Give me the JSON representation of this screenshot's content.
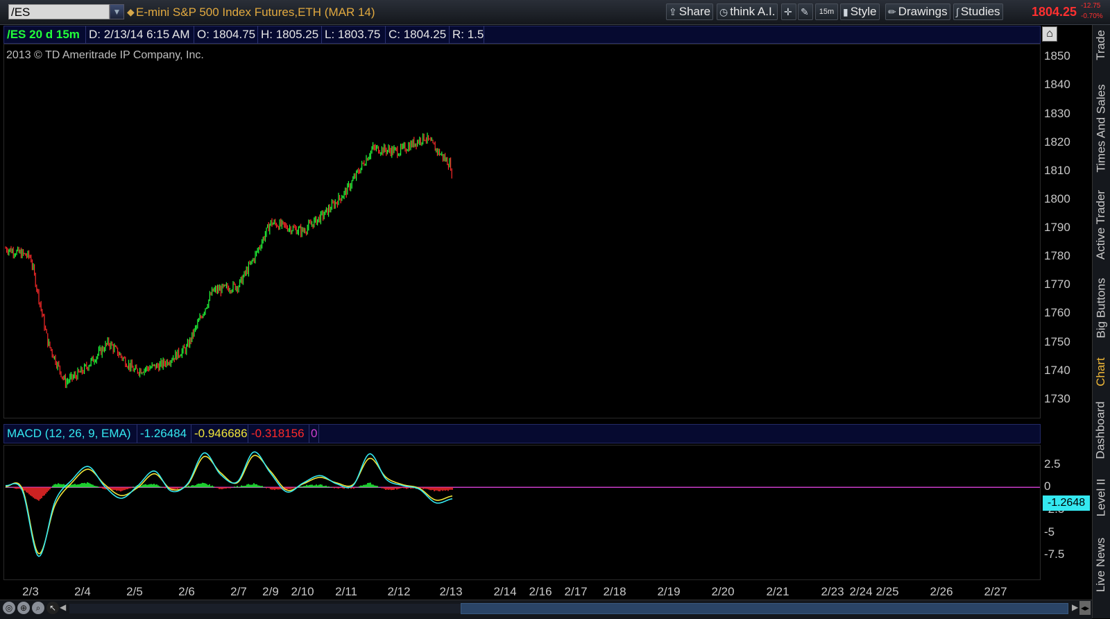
{
  "toolbar": {
    "symbol": "/ES",
    "title": "E-mini S&P 500 Index Futures,ETH (MAR 14)",
    "share_label": "Share",
    "thinkai_label": "think A.I.",
    "timeframe_label": "15m",
    "style_label": "Style",
    "drawings_label": "Drawings",
    "studies_label": "Studies",
    "last_price": "1804.25",
    "change": "-12.75",
    "change_pct": "-0.70%"
  },
  "info": {
    "symbol_period": "/ES 20 d 15m",
    "date": "D: 2/13/14 6:15 AM",
    "open": "O: 1804.75",
    "high": "H: 1805.25",
    "low": "L: 1803.75",
    "close": "C: 1804.25",
    "range": "R: 1.5"
  },
  "copyright": "2013 © TD Ameritrade IP Company, Inc.",
  "macd": {
    "label": "MACD (12, 26, 9, EMA)",
    "value": "-1.26484",
    "avg": "-0.946686",
    "diff": "-0.318156",
    "zero": "0",
    "tag": "-1.2648"
  },
  "side_tabs": [
    "Trade",
    "Times And Sales",
    "Active Trader",
    "Big Buttons",
    "Chart",
    "Dashboard",
    "Level II",
    "Live News"
  ],
  "colors": {
    "up": "#22ff3a",
    "down": "#ff2a2a",
    "macd_value": "#34e8f0",
    "macd_avg": "#f2e63a",
    "macd_diff_pos": "#22ff3a",
    "macd_diff_neg": "#ff2a2a",
    "zero_line": "#c83cc8",
    "accent": "#e1a93f"
  },
  "chart_data": [
    {
      "type": "candlestick",
      "title": "E-mini S&P 500 Index Futures,ETH (MAR 14)",
      "x_labels": [
        "2/3",
        "2/4",
        "2/5",
        "2/6",
        "2/7",
        "2/9",
        "2/10",
        "2/11",
        "2/12",
        "2/13",
        "2/14",
        "2/16",
        "2/17",
        "2/18",
        "2/19",
        "2/20",
        "2/21",
        "2/23",
        "2/24",
        "2/25",
        "2/26",
        "2/27"
      ],
      "y_ticks": [
        1730,
        1740,
        1750,
        1760,
        1770,
        1780,
        1790,
        1800,
        1810,
        1820,
        1830,
        1840,
        1850
      ],
      "ylim": [
        1728,
        1853
      ],
      "approx_close_path": [
        {
          "x": "2/2",
          "y": 1783
        },
        {
          "x": "2/3",
          "y": 1780
        },
        {
          "x": "2/3",
          "y": 1750
        },
        {
          "x": "2/3",
          "y": 1736
        },
        {
          "x": "2/4",
          "y": 1740
        },
        {
          "x": "2/4",
          "y": 1750
        },
        {
          "x": "2/5",
          "y": 1740
        },
        {
          "x": "2/5",
          "y": 1742
        },
        {
          "x": "2/6",
          "y": 1748
        },
        {
          "x": "2/6",
          "y": 1768
        },
        {
          "x": "2/7",
          "y": 1770
        },
        {
          "x": "2/7",
          "y": 1780
        },
        {
          "x": "2/9",
          "y": 1792
        },
        {
          "x": "2/10",
          "y": 1789
        },
        {
          "x": "2/10",
          "y": 1795
        },
        {
          "x": "2/11",
          "y": 1803
        },
        {
          "x": "2/11",
          "y": 1818
        },
        {
          "x": "2/12",
          "y": 1817
        },
        {
          "x": "2/12",
          "y": 1822
        },
        {
          "x": "2/13",
          "y": 1812
        },
        {
          "x": "2/13",
          "y": 1804
        }
      ],
      "last": 1804.25
    },
    {
      "type": "line",
      "title": "MACD (12, 26, 9, EMA)",
      "y_ticks": [
        2.5,
        0,
        -2.5,
        -5,
        -7.5
      ],
      "ylim": [
        -9,
        4
      ],
      "series": [
        {
          "name": "Value",
          "values": [
            0.2,
            -0.3,
            -7.6,
            -1.5,
            0.8,
            2.3,
            0.1,
            -1.2,
            0.2,
            1.8,
            -0.4,
            0.4,
            3.8,
            1.4,
            0.6,
            3.9,
            1.6,
            -0.5,
            0.5,
            1.3,
            0.4,
            0.2,
            3.7,
            0.9,
            0.2,
            -0.2,
            -1.7,
            -1.26
          ]
        },
        {
          "name": "Avg",
          "values": [
            0.1,
            -0.1,
            -7.3,
            -1.9,
            0.5,
            2.0,
            0.3,
            -0.9,
            0.0,
            1.5,
            -0.2,
            0.3,
            3.4,
            1.6,
            0.5,
            3.5,
            1.8,
            -0.3,
            0.4,
            1.1,
            0.5,
            0.3,
            3.2,
            1.1,
            0.3,
            -0.1,
            -1.4,
            -0.95
          ]
        },
        {
          "name": "Diff",
          "values": [
            0.1,
            -0.2,
            -1.5,
            0.4,
            0.3,
            0.5,
            -0.2,
            -0.4,
            0.2,
            0.4,
            -0.3,
            0.1,
            0.5,
            -0.2,
            0.1,
            0.4,
            -0.2,
            -0.3,
            0.2,
            0.3,
            -0.1,
            -0.1,
            0.5,
            -0.3,
            -0.1,
            -0.1,
            -0.4,
            -0.32
          ]
        }
      ]
    }
  ]
}
